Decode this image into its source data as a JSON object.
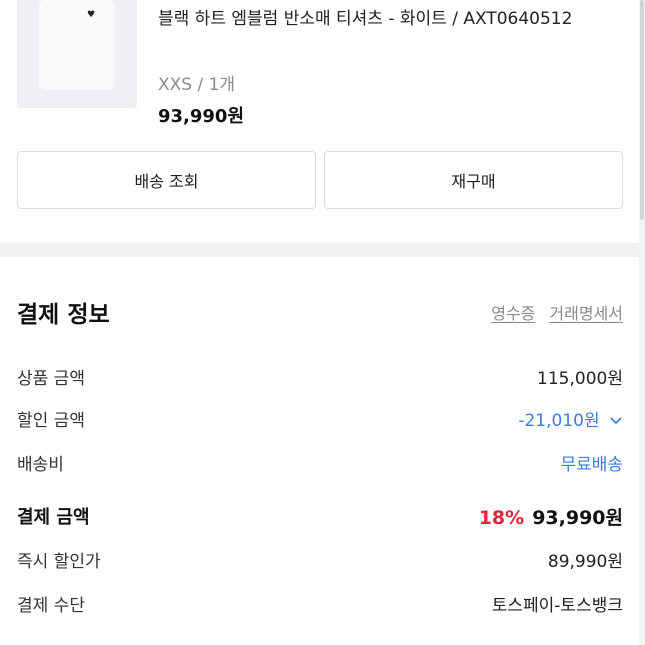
{
  "product": {
    "name": "블랙 하트 엠블럼 반소매 티셔츠 - 화이트 / AXT0640512",
    "option": "XXS / 1개",
    "price": "93,990원"
  },
  "actions": {
    "track_label": "배송 조회",
    "reorder_label": "재구매"
  },
  "payment": {
    "title": "결제 정보",
    "receipt_link": "영수증",
    "statement_link": "거래명세서",
    "rows": [
      {
        "label": "상품 금액",
        "value": "115,000원"
      },
      {
        "label": "할인 금액",
        "value": "-21,010원"
      },
      {
        "label": "배송비",
        "value": "무료배송"
      },
      {
        "label": "결제 금액",
        "discount": "18%",
        "value": "93,990원"
      },
      {
        "label": "즉시 할인가",
        "value": "89,990원"
      },
      {
        "label": "결제 수단",
        "value": "토스페이-토스뱅크"
      }
    ]
  },
  "colors": {
    "accent_blue": "#3a7ce0",
    "discount_red": "#e0283a",
    "divider": "#f2f2f4"
  },
  "icons": [
    "chevron-down-icon",
    "heart-icon"
  ]
}
